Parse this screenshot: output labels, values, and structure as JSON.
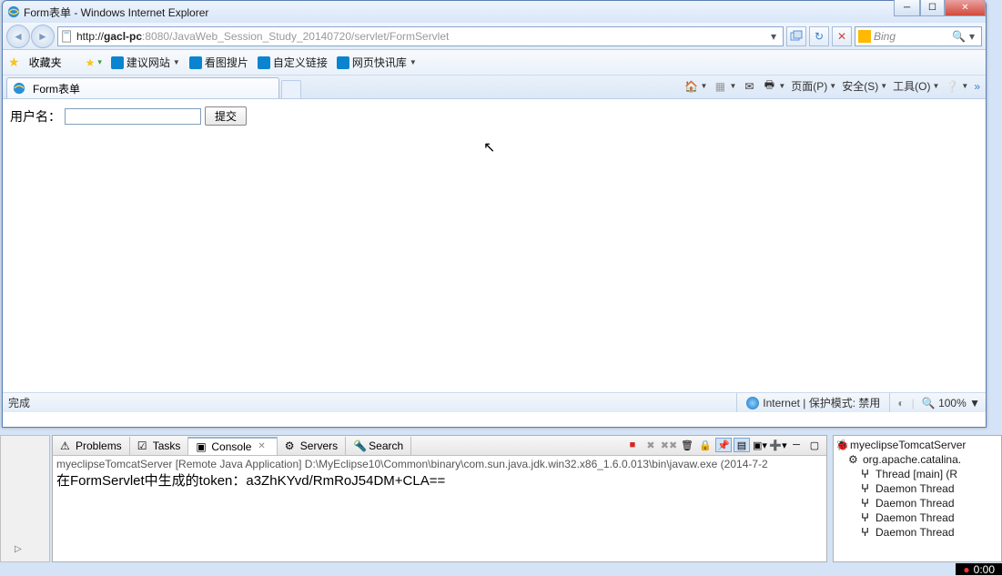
{
  "window": {
    "title": "Form表单 - Windows Internet Explorer"
  },
  "nav": {
    "url_scheme": "http://",
    "url_host": "gacl-pc",
    "url_rest": ":8080/JavaWeb_Session_Study_20140720/servlet/FormServlet",
    "refresh_glyph": "↻",
    "stop_glyph": "✕"
  },
  "search": {
    "placeholder": "Bing",
    "mag_glyph": "🔍"
  },
  "favbar": {
    "label": "收藏夹",
    "items": [
      {
        "label": "建议网站",
        "has_dd": true
      },
      {
        "label": "看图搜片"
      },
      {
        "label": "自定义链接"
      },
      {
        "label": "网页快讯库",
        "has_dd": true
      }
    ]
  },
  "tab": {
    "title": "Form表单"
  },
  "tabtools": {
    "page": "页面(P)",
    "safety": "安全(S)",
    "tools": "工具(O)"
  },
  "page": {
    "label": "用户名：",
    "submit": "提交"
  },
  "status": {
    "left": "完成",
    "zone": "Internet | 保护模式: 禁用",
    "zoom": "100%"
  },
  "eclipse": {
    "tabs": {
      "problems": "Problems",
      "tasks": "Tasks",
      "console": "Console",
      "servers": "Servers",
      "search": "Search"
    },
    "header": "myeclipseTomcatServer [Remote Java Application] D:\\MyEclipse10\\Common\\binary\\com.sun.java.jdk.win32.x86_1.6.0.013\\bin\\javaw.exe (2014-7-2",
    "output": "在FormServlet中生成的token：a3ZhKYvd/RmRoJ54DM+CLA=="
  },
  "debug": {
    "root": "myeclipseTomcatServer",
    "node1": "org.apache.catalina.",
    "threads": [
      "Thread [main] (R",
      "Daemon Thread",
      "Daemon Thread",
      "Daemon Thread",
      "Daemon Thread"
    ]
  },
  "clock": "0:00"
}
